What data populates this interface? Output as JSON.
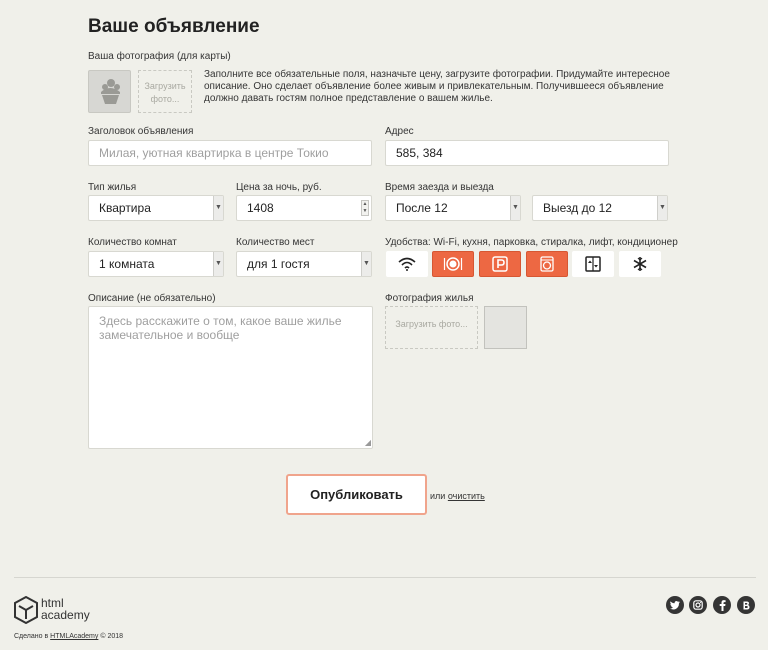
{
  "form": {
    "title": "Ваше объявление",
    "avatar_label": "Ваша фотография (для карты)",
    "upload_small": "Загрузить фото...",
    "notice": "Заполните все обязательные поля, назначьте цену, загрузите фотографии. Придумайте интересное описание. Оно сделает объявление более живым и привлекательным. Получившееся объявление должно давать гостям полное представление о вашем жилье."
  },
  "fields": {
    "title_label": "Заголовок объявления",
    "title_placeholder": "Милая, уютная квартирка в центре Токио",
    "address_label": "Адрес",
    "address_value": "585, 384",
    "type_label": "Тип жилья",
    "type_value": "Квартира",
    "price_label": "Цена за ночь, руб.",
    "price_value": "1408",
    "time_label": "Время заезда и выезда",
    "checkin_value": "После 12",
    "checkout_value": "Выезд до 12",
    "rooms_label": "Количество комнат",
    "rooms_value": "1 комната",
    "capacity_label": "Количество мест",
    "capacity_value": "для 1 гостя",
    "features_label": "Удобства: Wi-Fi, кухня, парковка, стиралка, лифт, кондиционер",
    "description_label": "Описание (не обязательно)",
    "description_placeholder": "Здесь расскажите о том, какое ваше жилье замечательное и вообще",
    "photos_label": "Фотография жилья",
    "upload_big": "Загрузить фото..."
  },
  "features": [
    {
      "icon": "wifi-icon",
      "checked": false
    },
    {
      "icon": "dishwasher-icon",
      "checked": true
    },
    {
      "icon": "parking-icon",
      "checked": true
    },
    {
      "icon": "washer-icon",
      "checked": true
    },
    {
      "icon": "elevator-icon",
      "checked": false
    },
    {
      "icon": "conditioner-icon",
      "checked": false
    }
  ],
  "actions": {
    "publish": "Опубликовать",
    "or": "или",
    "reset": "очистить"
  },
  "footer": {
    "logo_line1": "html",
    "logo_line2": "academy",
    "made_prefix": "Сделано в",
    "made_link": "HTMLAcademy",
    "made_suffix": "© 2018",
    "socials": [
      "twitter-icon",
      "instagram-icon",
      "facebook-icon",
      "vk-icon"
    ]
  },
  "colors": {
    "accent": "#ed6843",
    "background": "#f0f0ea"
  }
}
